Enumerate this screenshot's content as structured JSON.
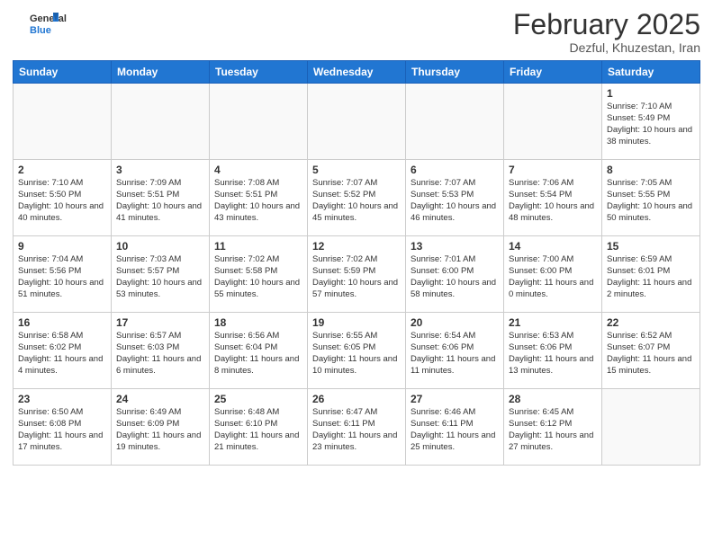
{
  "header": {
    "logo_general": "General",
    "logo_blue": "Blue",
    "calendar_title": "February 2025",
    "calendar_subtitle": "Dezful, Khuzestan, Iran"
  },
  "weekdays": [
    "Sunday",
    "Monday",
    "Tuesday",
    "Wednesday",
    "Thursday",
    "Friday",
    "Saturday"
  ],
  "weeks": [
    [
      {
        "day": "",
        "info": ""
      },
      {
        "day": "",
        "info": ""
      },
      {
        "day": "",
        "info": ""
      },
      {
        "day": "",
        "info": ""
      },
      {
        "day": "",
        "info": ""
      },
      {
        "day": "",
        "info": ""
      },
      {
        "day": "1",
        "info": "Sunrise: 7:10 AM\nSunset: 5:49 PM\nDaylight: 10 hours and 38 minutes."
      }
    ],
    [
      {
        "day": "2",
        "info": "Sunrise: 7:10 AM\nSunset: 5:50 PM\nDaylight: 10 hours and 40 minutes."
      },
      {
        "day": "3",
        "info": "Sunrise: 7:09 AM\nSunset: 5:51 PM\nDaylight: 10 hours and 41 minutes."
      },
      {
        "day": "4",
        "info": "Sunrise: 7:08 AM\nSunset: 5:51 PM\nDaylight: 10 hours and 43 minutes."
      },
      {
        "day": "5",
        "info": "Sunrise: 7:07 AM\nSunset: 5:52 PM\nDaylight: 10 hours and 45 minutes."
      },
      {
        "day": "6",
        "info": "Sunrise: 7:07 AM\nSunset: 5:53 PM\nDaylight: 10 hours and 46 minutes."
      },
      {
        "day": "7",
        "info": "Sunrise: 7:06 AM\nSunset: 5:54 PM\nDaylight: 10 hours and 48 minutes."
      },
      {
        "day": "8",
        "info": "Sunrise: 7:05 AM\nSunset: 5:55 PM\nDaylight: 10 hours and 50 minutes."
      }
    ],
    [
      {
        "day": "9",
        "info": "Sunrise: 7:04 AM\nSunset: 5:56 PM\nDaylight: 10 hours and 51 minutes."
      },
      {
        "day": "10",
        "info": "Sunrise: 7:03 AM\nSunset: 5:57 PM\nDaylight: 10 hours and 53 minutes."
      },
      {
        "day": "11",
        "info": "Sunrise: 7:02 AM\nSunset: 5:58 PM\nDaylight: 10 hours and 55 minutes."
      },
      {
        "day": "12",
        "info": "Sunrise: 7:02 AM\nSunset: 5:59 PM\nDaylight: 10 hours and 57 minutes."
      },
      {
        "day": "13",
        "info": "Sunrise: 7:01 AM\nSunset: 6:00 PM\nDaylight: 10 hours and 58 minutes."
      },
      {
        "day": "14",
        "info": "Sunrise: 7:00 AM\nSunset: 6:00 PM\nDaylight: 11 hours and 0 minutes."
      },
      {
        "day": "15",
        "info": "Sunrise: 6:59 AM\nSunset: 6:01 PM\nDaylight: 11 hours and 2 minutes."
      }
    ],
    [
      {
        "day": "16",
        "info": "Sunrise: 6:58 AM\nSunset: 6:02 PM\nDaylight: 11 hours and 4 minutes."
      },
      {
        "day": "17",
        "info": "Sunrise: 6:57 AM\nSunset: 6:03 PM\nDaylight: 11 hours and 6 minutes."
      },
      {
        "day": "18",
        "info": "Sunrise: 6:56 AM\nSunset: 6:04 PM\nDaylight: 11 hours and 8 minutes."
      },
      {
        "day": "19",
        "info": "Sunrise: 6:55 AM\nSunset: 6:05 PM\nDaylight: 11 hours and 10 minutes."
      },
      {
        "day": "20",
        "info": "Sunrise: 6:54 AM\nSunset: 6:06 PM\nDaylight: 11 hours and 11 minutes."
      },
      {
        "day": "21",
        "info": "Sunrise: 6:53 AM\nSunset: 6:06 PM\nDaylight: 11 hours and 13 minutes."
      },
      {
        "day": "22",
        "info": "Sunrise: 6:52 AM\nSunset: 6:07 PM\nDaylight: 11 hours and 15 minutes."
      }
    ],
    [
      {
        "day": "23",
        "info": "Sunrise: 6:50 AM\nSunset: 6:08 PM\nDaylight: 11 hours and 17 minutes."
      },
      {
        "day": "24",
        "info": "Sunrise: 6:49 AM\nSunset: 6:09 PM\nDaylight: 11 hours and 19 minutes."
      },
      {
        "day": "25",
        "info": "Sunrise: 6:48 AM\nSunset: 6:10 PM\nDaylight: 11 hours and 21 minutes."
      },
      {
        "day": "26",
        "info": "Sunrise: 6:47 AM\nSunset: 6:11 PM\nDaylight: 11 hours and 23 minutes."
      },
      {
        "day": "27",
        "info": "Sunrise: 6:46 AM\nSunset: 6:11 PM\nDaylight: 11 hours and 25 minutes."
      },
      {
        "day": "28",
        "info": "Sunrise: 6:45 AM\nSunset: 6:12 PM\nDaylight: 11 hours and 27 minutes."
      },
      {
        "day": "",
        "info": ""
      }
    ]
  ]
}
